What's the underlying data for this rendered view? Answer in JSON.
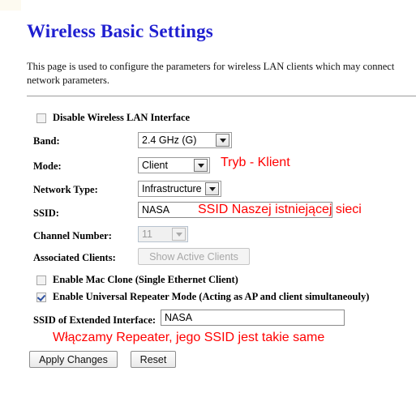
{
  "page": {
    "title": "Wireless Basic Settings",
    "intro_line1": "This page is used to configure the parameters for wireless LAN clients which may connect",
    "intro_line2": "network parameters."
  },
  "form": {
    "disable_wlan": {
      "label": "Disable Wireless LAN Interface",
      "checked": false
    },
    "band": {
      "label": "Band:",
      "value": "2.4 GHz (G)"
    },
    "mode": {
      "label": "Mode:",
      "value": "Client"
    },
    "network_type": {
      "label": "Network Type:",
      "value": "Infrastructure"
    },
    "ssid": {
      "label": "SSID:",
      "value": "NASA"
    },
    "channel_number": {
      "label": "Channel Number:",
      "value": "11"
    },
    "associated_clients": {
      "label": "Associated Clients:",
      "button": "Show Active Clients"
    },
    "mac_clone": {
      "label": "Enable Mac Clone (Single Ethernet Client)",
      "checked": false
    },
    "universal_repeater": {
      "label": "Enable Universal Repeater Mode (Acting as AP and client simultaneouly)",
      "checked": true
    },
    "extended_ssid": {
      "label": "SSID of Extended Interface:",
      "value": "NASA"
    },
    "apply_button": "Apply Changes",
    "reset_button": "Reset"
  },
  "annotations": {
    "mode": "Tryb - Klient",
    "ssid": "SSID Naszej istniejącej sieci",
    "repeater": "Włączamy Repeater, jego SSID jest takie same",
    "color": "#ff0000"
  }
}
